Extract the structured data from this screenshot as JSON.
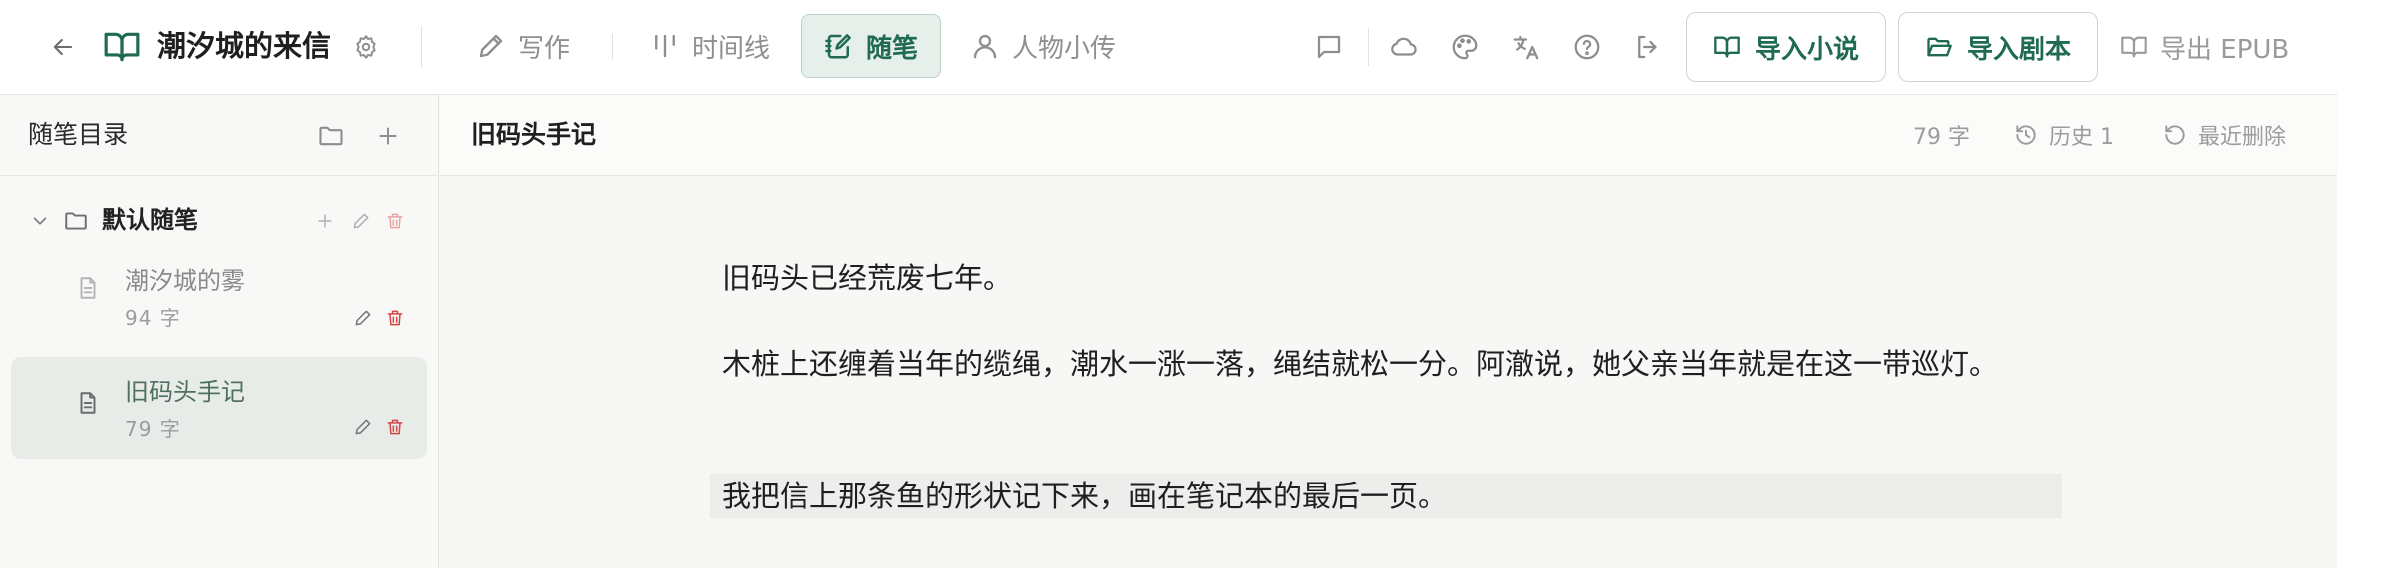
{
  "header": {
    "back_icon": "arrow-left-icon",
    "book_icon": "book-open-icon",
    "app_title": "潮汐城的来信",
    "settings_icon": "gear-icon",
    "tabs": [
      {
        "label": "写作",
        "icon": "pen-icon",
        "active": false
      },
      {
        "label": "时间线",
        "icon": "timeline-icon",
        "active": false
      },
      {
        "label": "随笔",
        "icon": "notebook-pen-icon",
        "active": true
      },
      {
        "label": "人物小传",
        "icon": "user-icon",
        "active": false
      }
    ],
    "tool_icons": [
      "message-square-icon",
      "cloud-icon",
      "palette-icon",
      "translate-icon",
      "help-circle-icon",
      "log-out-icon"
    ],
    "import_novel_label": "导入小说",
    "import_script_label": "导入剧本",
    "export_epub_label": "导出 EPUB"
  },
  "sidebar": {
    "title": "随笔目录",
    "folder": {
      "name": "默认随笔",
      "expanded": true
    },
    "notes": [
      {
        "title": "潮汐城的雾",
        "count": "94 字",
        "active": false
      },
      {
        "title": "旧码头手记",
        "count": "79 字",
        "active": true
      }
    ]
  },
  "document": {
    "title": "旧码头手记",
    "word_count": "79 字",
    "history_label": "历史 1",
    "recent_deleted_label": "最近删除",
    "paragraphs": [
      "旧码头已经荒废七年。",
      "木桩上还缠着当年的缆绳，潮水一涨一落，绳结就松一分。阿澈说，她父亲当年就是在这一带巡灯。",
      "我把信上那条鱼的形状记下来，画在笔记本的最后一页。"
    ]
  },
  "colors": {
    "accent": "#1f6a52",
    "accent_bg": "#e7efeb",
    "delete_red": "#d64545",
    "highlight_bg": "#ededeb"
  }
}
